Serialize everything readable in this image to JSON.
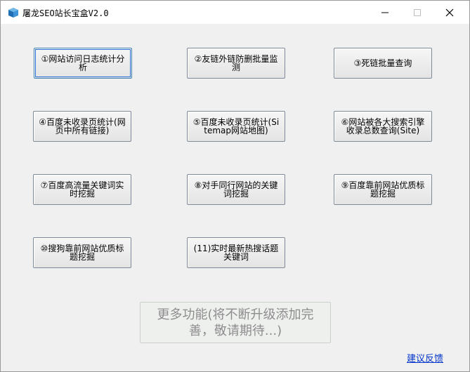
{
  "window": {
    "title": "屠龙SEO站长宝盒V2.0"
  },
  "buttons": [
    {
      "label": "①网站访问日志统计分析"
    },
    {
      "label": "②友链外链防删批量监测"
    },
    {
      "label": "③死链批量查询"
    },
    {
      "label": "④百度未收录页统计(网页中所有链接)"
    },
    {
      "label": "⑤百度未收录页统计(Sitemap网站地图)"
    },
    {
      "label": "⑥网站被各大搜索引擎收录总数查询(Site)"
    },
    {
      "label": "⑦百度高流量关键词实时挖掘"
    },
    {
      "label": "⑧对手同行网站的关键词挖掘"
    },
    {
      "label": "⑨百度靠前网站优质标题挖掘"
    },
    {
      "label": "⑩搜狗靠前网站优质标题挖掘"
    },
    {
      "label": "(11)实时最新热搜话题关键词"
    }
  ],
  "more_button": {
    "label": "更多功能(将不断升级添加完善，敬请期待...)"
  },
  "feedback_link": {
    "label": "建议反馈"
  }
}
